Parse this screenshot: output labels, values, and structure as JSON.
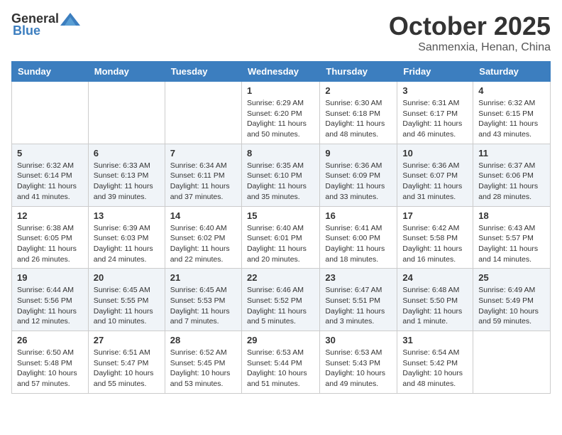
{
  "header": {
    "logo_general": "General",
    "logo_blue": "Blue",
    "month_title": "October 2025",
    "location": "Sanmenxia, Henan, China"
  },
  "days_of_week": [
    "Sunday",
    "Monday",
    "Tuesday",
    "Wednesday",
    "Thursday",
    "Friday",
    "Saturday"
  ],
  "weeks": [
    [
      {
        "day": "",
        "info": ""
      },
      {
        "day": "",
        "info": ""
      },
      {
        "day": "",
        "info": ""
      },
      {
        "day": "1",
        "info": "Sunrise: 6:29 AM\nSunset: 6:20 PM\nDaylight: 11 hours and 50 minutes."
      },
      {
        "day": "2",
        "info": "Sunrise: 6:30 AM\nSunset: 6:18 PM\nDaylight: 11 hours and 48 minutes."
      },
      {
        "day": "3",
        "info": "Sunrise: 6:31 AM\nSunset: 6:17 PM\nDaylight: 11 hours and 46 minutes."
      },
      {
        "day": "4",
        "info": "Sunrise: 6:32 AM\nSunset: 6:15 PM\nDaylight: 11 hours and 43 minutes."
      }
    ],
    [
      {
        "day": "5",
        "info": "Sunrise: 6:32 AM\nSunset: 6:14 PM\nDaylight: 11 hours and 41 minutes."
      },
      {
        "day": "6",
        "info": "Sunrise: 6:33 AM\nSunset: 6:13 PM\nDaylight: 11 hours and 39 minutes."
      },
      {
        "day": "7",
        "info": "Sunrise: 6:34 AM\nSunset: 6:11 PM\nDaylight: 11 hours and 37 minutes."
      },
      {
        "day": "8",
        "info": "Sunrise: 6:35 AM\nSunset: 6:10 PM\nDaylight: 11 hours and 35 minutes."
      },
      {
        "day": "9",
        "info": "Sunrise: 6:36 AM\nSunset: 6:09 PM\nDaylight: 11 hours and 33 minutes."
      },
      {
        "day": "10",
        "info": "Sunrise: 6:36 AM\nSunset: 6:07 PM\nDaylight: 11 hours and 31 minutes."
      },
      {
        "day": "11",
        "info": "Sunrise: 6:37 AM\nSunset: 6:06 PM\nDaylight: 11 hours and 28 minutes."
      }
    ],
    [
      {
        "day": "12",
        "info": "Sunrise: 6:38 AM\nSunset: 6:05 PM\nDaylight: 11 hours and 26 minutes."
      },
      {
        "day": "13",
        "info": "Sunrise: 6:39 AM\nSunset: 6:03 PM\nDaylight: 11 hours and 24 minutes."
      },
      {
        "day": "14",
        "info": "Sunrise: 6:40 AM\nSunset: 6:02 PM\nDaylight: 11 hours and 22 minutes."
      },
      {
        "day": "15",
        "info": "Sunrise: 6:40 AM\nSunset: 6:01 PM\nDaylight: 11 hours and 20 minutes."
      },
      {
        "day": "16",
        "info": "Sunrise: 6:41 AM\nSunset: 6:00 PM\nDaylight: 11 hours and 18 minutes."
      },
      {
        "day": "17",
        "info": "Sunrise: 6:42 AM\nSunset: 5:58 PM\nDaylight: 11 hours and 16 minutes."
      },
      {
        "day": "18",
        "info": "Sunrise: 6:43 AM\nSunset: 5:57 PM\nDaylight: 11 hours and 14 minutes."
      }
    ],
    [
      {
        "day": "19",
        "info": "Sunrise: 6:44 AM\nSunset: 5:56 PM\nDaylight: 11 hours and 12 minutes."
      },
      {
        "day": "20",
        "info": "Sunrise: 6:45 AM\nSunset: 5:55 PM\nDaylight: 11 hours and 10 minutes."
      },
      {
        "day": "21",
        "info": "Sunrise: 6:45 AM\nSunset: 5:53 PM\nDaylight: 11 hours and 7 minutes."
      },
      {
        "day": "22",
        "info": "Sunrise: 6:46 AM\nSunset: 5:52 PM\nDaylight: 11 hours and 5 minutes."
      },
      {
        "day": "23",
        "info": "Sunrise: 6:47 AM\nSunset: 5:51 PM\nDaylight: 11 hours and 3 minutes."
      },
      {
        "day": "24",
        "info": "Sunrise: 6:48 AM\nSunset: 5:50 PM\nDaylight: 11 hours and 1 minute."
      },
      {
        "day": "25",
        "info": "Sunrise: 6:49 AM\nSunset: 5:49 PM\nDaylight: 10 hours and 59 minutes."
      }
    ],
    [
      {
        "day": "26",
        "info": "Sunrise: 6:50 AM\nSunset: 5:48 PM\nDaylight: 10 hours and 57 minutes."
      },
      {
        "day": "27",
        "info": "Sunrise: 6:51 AM\nSunset: 5:47 PM\nDaylight: 10 hours and 55 minutes."
      },
      {
        "day": "28",
        "info": "Sunrise: 6:52 AM\nSunset: 5:45 PM\nDaylight: 10 hours and 53 minutes."
      },
      {
        "day": "29",
        "info": "Sunrise: 6:53 AM\nSunset: 5:44 PM\nDaylight: 10 hours and 51 minutes."
      },
      {
        "day": "30",
        "info": "Sunrise: 6:53 AM\nSunset: 5:43 PM\nDaylight: 10 hours and 49 minutes."
      },
      {
        "day": "31",
        "info": "Sunrise: 6:54 AM\nSunset: 5:42 PM\nDaylight: 10 hours and 48 minutes."
      },
      {
        "day": "",
        "info": ""
      }
    ]
  ]
}
